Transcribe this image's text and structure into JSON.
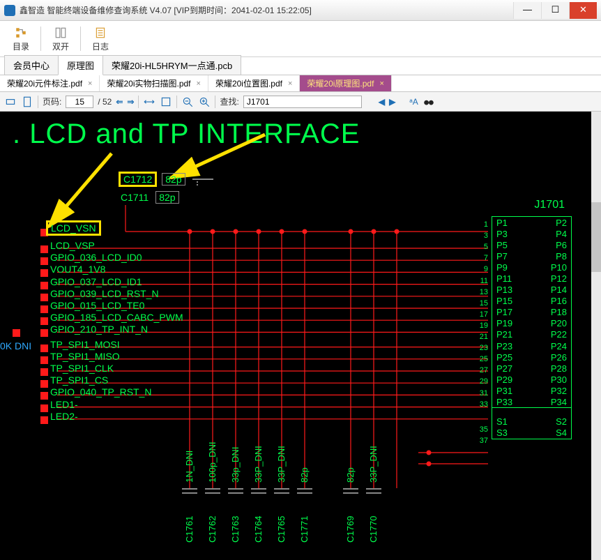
{
  "window": {
    "title": "鑫智造 智能终端设备维修查询系统 V4.07 [VIP到期时间：2041-02-01 15:22:05]"
  },
  "toolbar": {
    "catalog": "目录",
    "dual": "双开",
    "log": "日志"
  },
  "top_tabs": [
    {
      "label": "会员中心",
      "active": false
    },
    {
      "label": "原理图",
      "active": true
    },
    {
      "label": "荣耀20i-HL5HRYM一点通.pcb",
      "active": false
    }
  ],
  "doc_tabs": [
    {
      "label": "荣耀20i元件标注.pdf",
      "active": false
    },
    {
      "label": "荣耀20i实物扫描图.pdf",
      "active": false
    },
    {
      "label": "荣耀20i位置图.pdf",
      "active": false
    },
    {
      "label": "荣耀20i原理图.pdf",
      "active": true
    }
  ],
  "nav": {
    "page_label": "页码:",
    "page": "15",
    "pages": "/ 52",
    "find_label": "查找:",
    "find_value": "J1701",
    "aA": "ᵃA"
  },
  "schematic": {
    "title": ". LCD and TP INTERFACE",
    "hi_net": "LCD_VSN",
    "hi_comp": "C1712",
    "c1711": "C1711",
    "cap82p": "82p",
    "conn_ref": "J1701",
    "blue_left": "0K DNI",
    "net_labels": [
      "LCD_VSP",
      "GPIO_036_LCD_ID0",
      "VOUT4_1V8",
      "GPIO_037_LCD_ID1",
      "GPIO_039_LCD_RST_N",
      "GPIO_015_LCD_TE0",
      "GPIO_185_LCD_CABC_PWM",
      "GPIO_210_TP_INT_N",
      "TP_SPI1_MOSI",
      "TP_SPI1_MISO",
      "TP_SPI1_CLK",
      "TP_SPI1_CS",
      "GPIO_040_TP_RST_N",
      "LED1-",
      "LED2-"
    ],
    "left_pins": [
      "1",
      "3",
      "5",
      "7",
      "9",
      "11",
      "13",
      "15",
      "17",
      "19",
      "21",
      "23",
      "25",
      "27",
      "29",
      "31",
      "33",
      "",
      "35",
      "37"
    ],
    "conn_rows": [
      [
        "P1",
        "P2"
      ],
      [
        "P3",
        "P4"
      ],
      [
        "P5",
        "P6"
      ],
      [
        "P7",
        "P8"
      ],
      [
        "P9",
        "P10"
      ],
      [
        "P11",
        "P12"
      ],
      [
        "P13",
        "P14"
      ],
      [
        "P15",
        "P16"
      ],
      [
        "P17",
        "P18"
      ],
      [
        "P19",
        "P20"
      ],
      [
        "P21",
        "P22"
      ],
      [
        "P23",
        "P24"
      ],
      [
        "P25",
        "P26"
      ],
      [
        "P27",
        "P28"
      ],
      [
        "P29",
        "P30"
      ],
      [
        "P31",
        "P32"
      ],
      [
        "P33",
        "P34"
      ]
    ],
    "conn_rows2": [
      [
        "S1",
        "S2"
      ],
      [
        "S3",
        "S4"
      ]
    ],
    "vcaps_top": [
      "1N_DNI",
      "100p_DNI",
      "33p_DNI",
      "33P_DNI",
      "33P_DNI",
      "82p",
      "",
      "82p",
      "33P_DNI",
      ""
    ],
    "vcaps_bot": [
      "C1761",
      "C1762",
      "C1763",
      "C1764",
      "C1765",
      "C1771",
      "",
      "C1769",
      "C1770",
      ""
    ]
  }
}
